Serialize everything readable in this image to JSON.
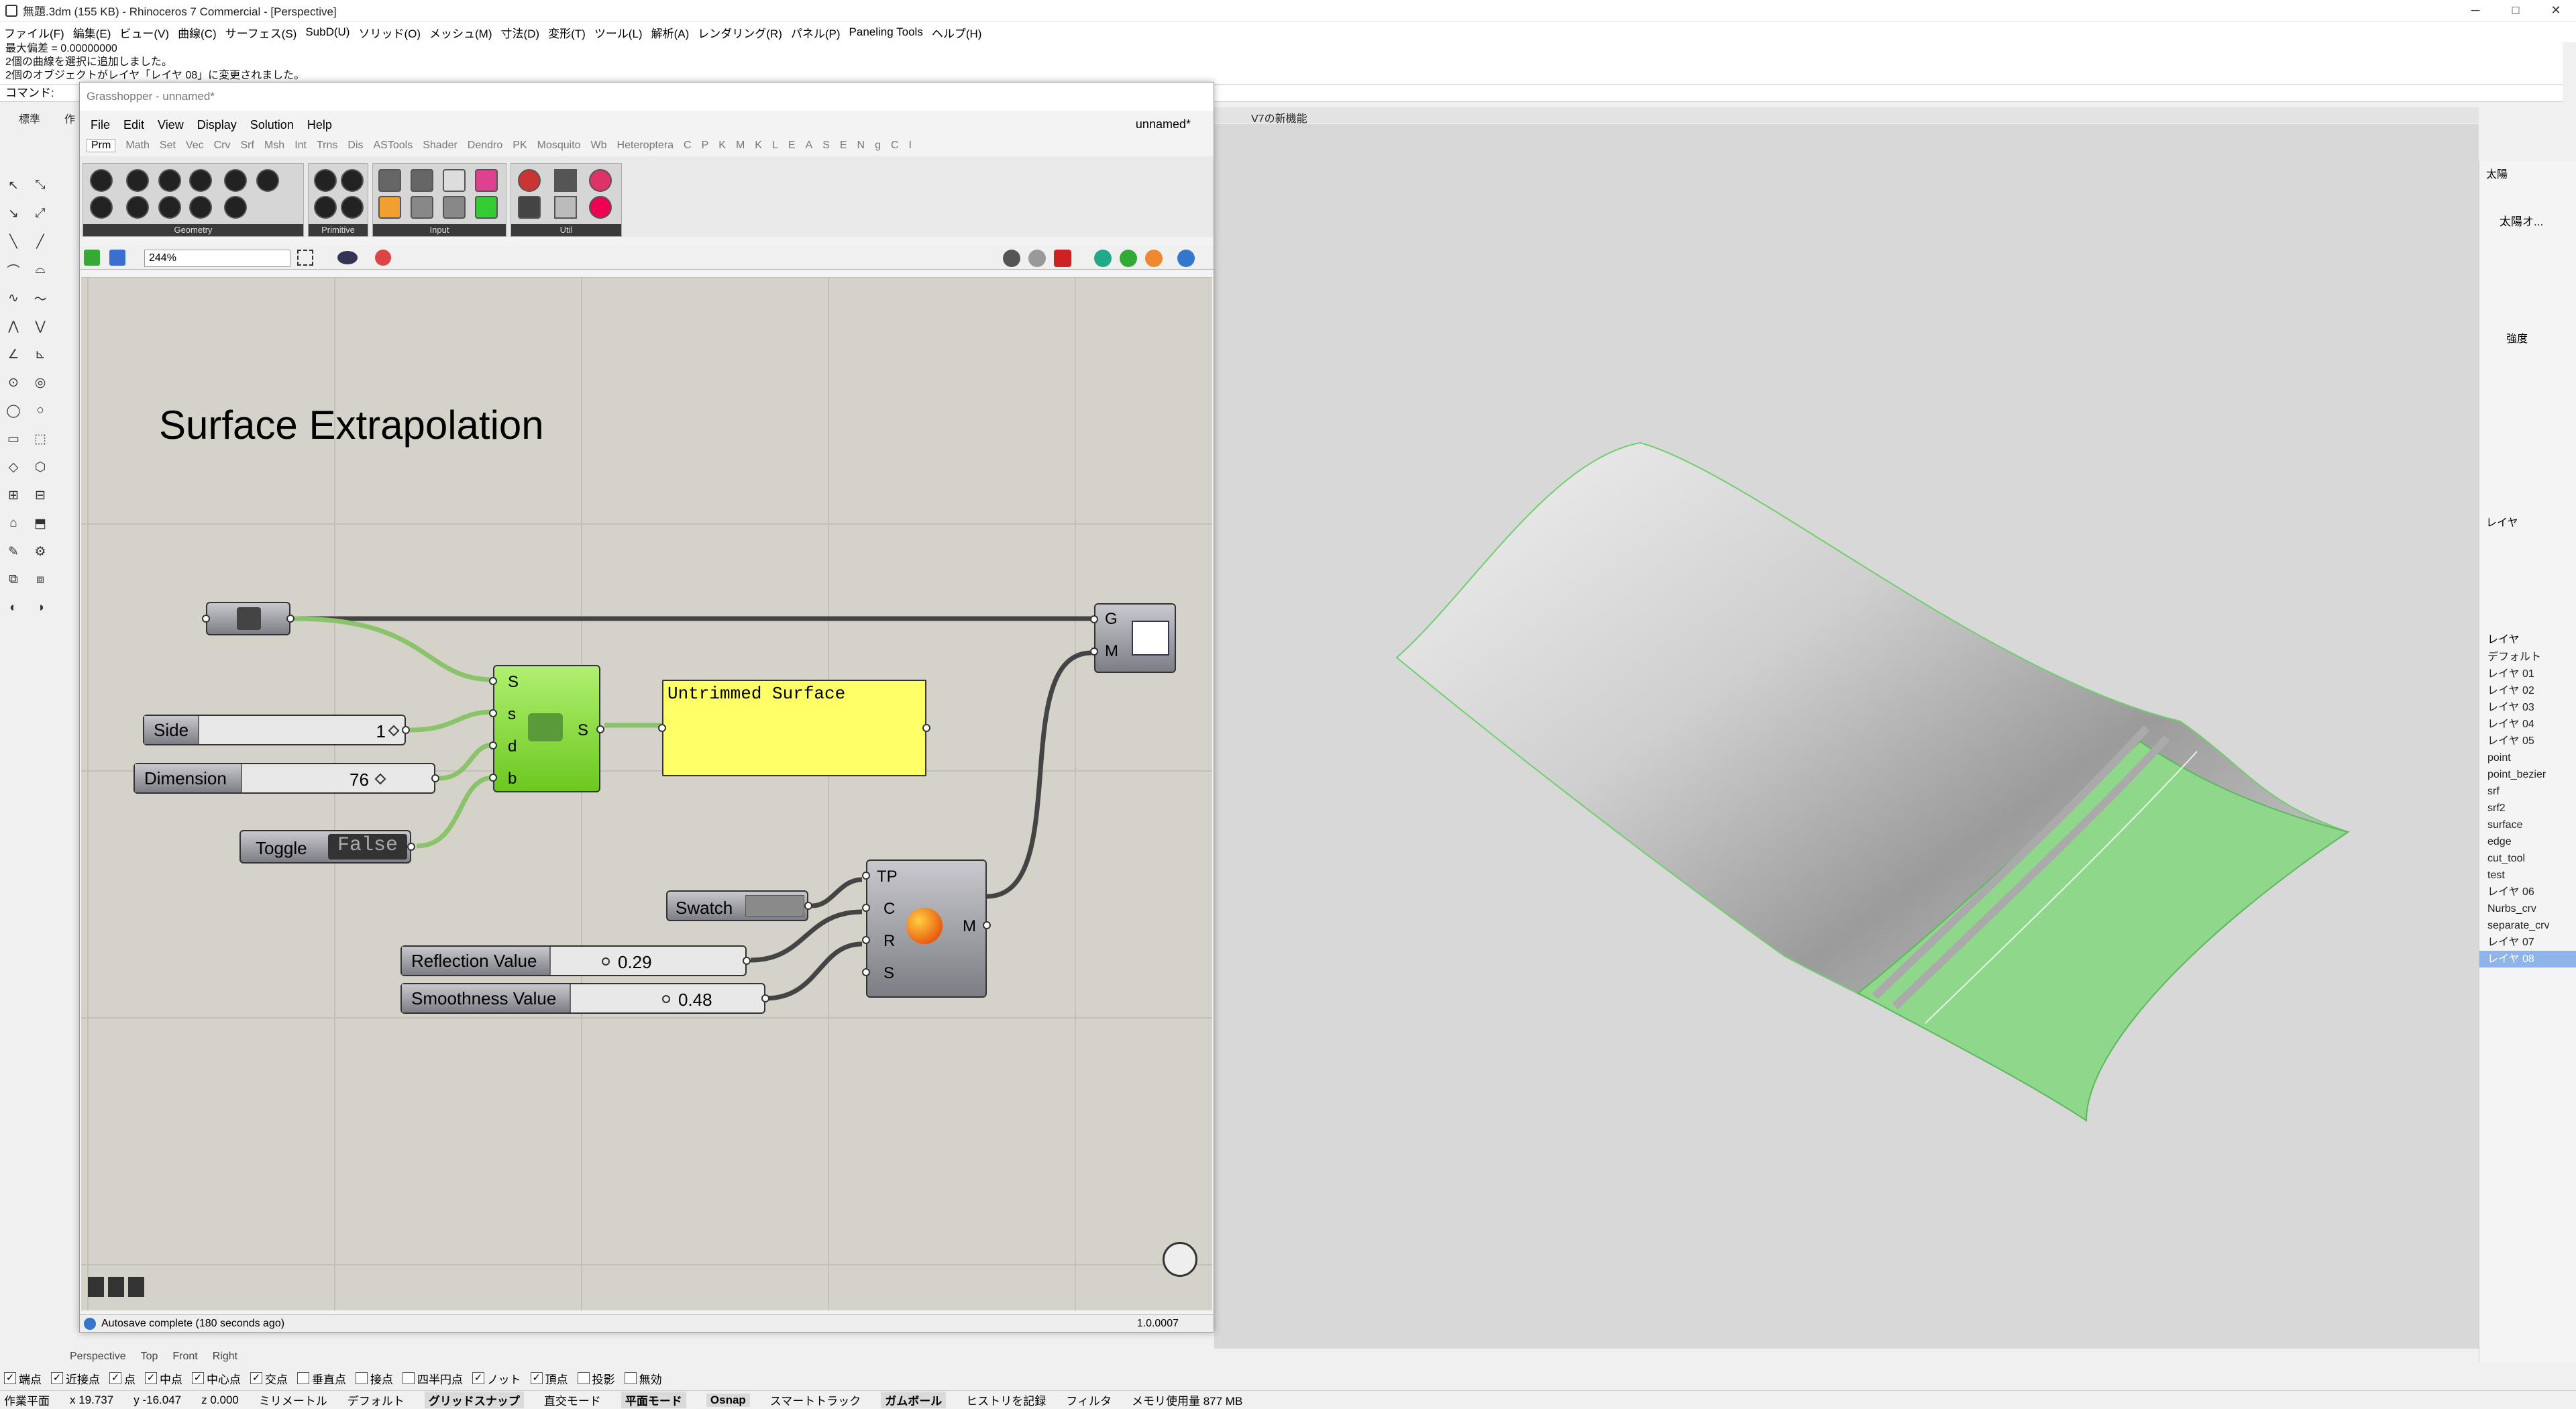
{
  "window": {
    "title": "無題.3dm (155 KB) - Rhinoceros 7 Commercial - [Perspective]",
    "controls": [
      "─",
      "□",
      "✕"
    ]
  },
  "menu": [
    "ファイル(F)",
    "編集(E)",
    "ビュー(V)",
    "曲線(C)",
    "サーフェス(S)",
    "SubD(U)",
    "ソリッド(O)",
    "メッシュ(M)",
    "寸法(D)",
    "変形(T)",
    "ツール(L)",
    "解析(A)",
    "レンダリング(R)",
    "パネル(P)",
    "Paneling Tools",
    "ヘルプ(H)"
  ],
  "command_history": [
    "最大偏差 = 0.00000000",
    "2個の曲線を選択に追加しました。",
    "2個のオブジェクトがレイヤ「レイヤ 08」に変更されました。"
  ],
  "command_prompt": "コマンド:",
  "toolbar_tabs": [
    "標準",
    "作"
  ],
  "viewport_tab": "V7の新機能",
  "viewport_tabs": [
    "Perspective",
    "Top",
    "Front",
    "Right"
  ],
  "gh": {
    "title": "Grasshopper - unnamed*",
    "document_name": "unnamed*",
    "menus": [
      "File",
      "Edit",
      "View",
      "Display",
      "Solution",
      "Help"
    ],
    "tabs": [
      "Prm",
      "Math",
      "Set",
      "Vec",
      "Crv",
      "Srf",
      "Msh",
      "Int",
      "Trns",
      "Dis",
      "ASTools",
      "Shader",
      "Dendro",
      "PK",
      "Mosquito",
      "Wb",
      "Heteroptera",
      "C",
      "P",
      "K",
      "M",
      "K",
      "L",
      "E",
      "A",
      "S",
      "E",
      "N",
      "g",
      "C",
      "I"
    ],
    "groups": [
      "Geometry",
      "Primitive",
      "Input",
      "Util"
    ],
    "zoom": "244%",
    "status": "Autosave complete (180 seconds ago)",
    "version": "1.0.0007",
    "canvas": {
      "title": "Surface Extrapolation",
      "sliders": [
        {
          "label": "Side",
          "value": "1"
        },
        {
          "label": "Dimension",
          "value": "76"
        },
        {
          "label": "Reflection Value",
          "value": "0.29"
        },
        {
          "label": "Smoothness Value",
          "value": "0.48"
        }
      ],
      "toggle": {
        "label": "Toggle",
        "value": "False"
      },
      "swatch_label": "Swatch",
      "panel_text": "Untrimmed Surface",
      "extrap_inputs": [
        "S",
        "s",
        "d",
        "b"
      ],
      "extrap_output": "S",
      "material_inputs": [
        "TP",
        "C",
        "R",
        "S"
      ],
      "material_output": "M",
      "preview_inputs": [
        "G",
        "M"
      ]
    }
  },
  "sun_panel": {
    "title": "太陽",
    "item": "太陽オ...",
    "intensity": "強度"
  },
  "layers_panel": {
    "title": "レイヤ",
    "header": "レイヤ",
    "layers": [
      "デフォルト",
      "レイヤ 01",
      "レイヤ 02",
      "レイヤ 03",
      "レイヤ 04",
      "レイヤ 05",
      "point",
      "point_bezier",
      "srf",
      "srf2",
      "surface",
      "edge",
      "cut_tool",
      "test",
      "レイヤ 06",
      "Nurbs_crv",
      "separate_crv",
      "レイヤ 07",
      "レイヤ 08"
    ],
    "selected": "レイヤ 08"
  },
  "osnaps": [
    {
      "label": "端点",
      "checked": true
    },
    {
      "label": "近接点",
      "checked": true
    },
    {
      "label": "点",
      "checked": true
    },
    {
      "label": "中点",
      "checked": true
    },
    {
      "label": "中心点",
      "checked": true
    },
    {
      "label": "交点",
      "checked": true
    },
    {
      "label": "垂直点",
      "checked": false
    },
    {
      "label": "接点",
      "checked": false
    },
    {
      "label": "四半円点",
      "checked": false
    },
    {
      "label": "ノット",
      "checked": true
    },
    {
      "label": "頂点",
      "checked": true
    },
    {
      "label": "投影",
      "checked": false
    },
    {
      "label": "無効",
      "checked": false
    }
  ],
  "statusbar": {
    "cplane": "作業平面",
    "x": "x 19.737",
    "y": "y -16.047",
    "z": "z 0.000",
    "units": "ミリメートル",
    "layer": "デフォルト",
    "grid_snap": "グリッドスナップ",
    "ortho": "直交モード",
    "planar": "平面モード",
    "osnap": "Osnap",
    "smarttrack": "スマートトラック",
    "gumball": "ガムボール",
    "history": "ヒストリを記録",
    "filter": "フィルタ",
    "memory": "メモリ使用量 877 MB"
  },
  "colors": {
    "accent_green": "#7dd87b",
    "component_green": "#7fcc3d",
    "panel_yellow": "#ffff66",
    "canvas_bg": "#d5d2ca"
  }
}
